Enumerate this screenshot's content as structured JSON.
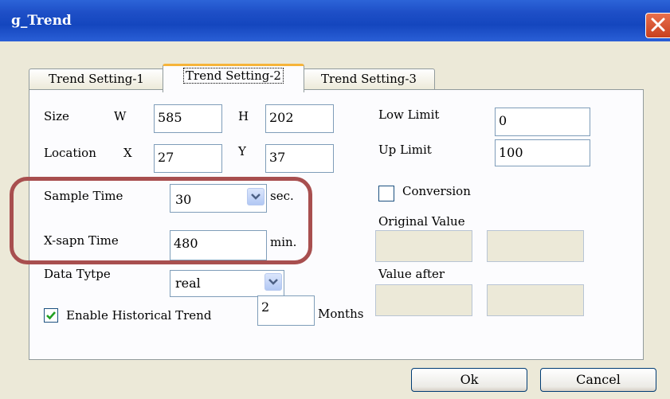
{
  "window": {
    "title": "g_Trend"
  },
  "tabs": [
    {
      "label": "Trend Setting-1"
    },
    {
      "label": "Trend Setting-2"
    },
    {
      "label": "Trend Setting-3"
    }
  ],
  "size": {
    "label": "Size",
    "w_label": "W",
    "w_value": "585",
    "h_label": "H",
    "h_value": "202"
  },
  "location": {
    "label": "Location",
    "x_label": "X",
    "x_value": "27",
    "y_label": "Y",
    "y_value": "37"
  },
  "low_limit": {
    "label": "Low Limit",
    "value": "0"
  },
  "up_limit": {
    "label": "Up Limit",
    "value": "100"
  },
  "conversion": {
    "label": "Conversion",
    "checked": false
  },
  "original_value": {
    "label": "Original Value"
  },
  "value_after": {
    "label": "Value after"
  },
  "sample_time": {
    "label": "Sample Time",
    "value": "30",
    "unit": "sec."
  },
  "x_span_time": {
    "label": "X-sapn Time",
    "value": "480",
    "unit": "min."
  },
  "data_type": {
    "label": "Data Tytpe",
    "value": "real"
  },
  "historical": {
    "label": "Enable Historical Trend",
    "checked": true,
    "value": "2",
    "unit": "Months"
  },
  "buttons": {
    "ok": "Ok",
    "cancel": "Cancel"
  },
  "colors": {
    "title_bar": "#1e4fc7",
    "highlight": "#a84f4f",
    "active_tab_accent": "#f6b43a"
  }
}
